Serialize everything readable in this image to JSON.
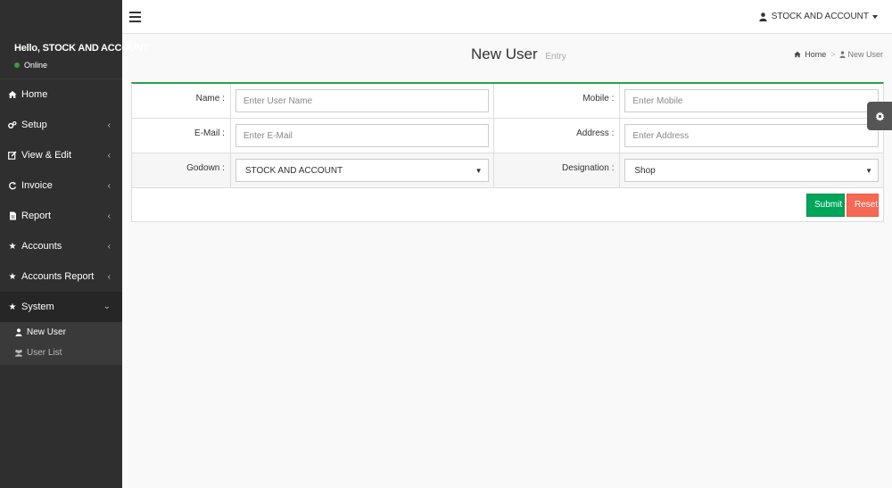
{
  "sidebar": {
    "greeting": "Hello, STOCK AND ACCOUNT",
    "status": "Online",
    "items": [
      {
        "label": "Home",
        "icon": "home-icon",
        "has_children": false
      },
      {
        "label": "Setup",
        "icon": "cogs-icon",
        "has_children": true
      },
      {
        "label": "View & Edit",
        "icon": "edit-icon",
        "has_children": true
      },
      {
        "label": "Invoice",
        "icon": "refresh-icon",
        "has_children": true
      },
      {
        "label": "Report",
        "icon": "file-icon",
        "has_children": true
      },
      {
        "label": "Accounts",
        "icon": "star-icon",
        "has_children": true
      },
      {
        "label": "Accounts Report",
        "icon": "star-icon",
        "has_children": true
      }
    ],
    "system": {
      "label": "System",
      "icon": "star-icon",
      "children": [
        {
          "label": "New User",
          "icon": "user-icon"
        },
        {
          "label": "User List",
          "icon": "users-icon"
        }
      ]
    }
  },
  "header": {
    "user_name": "STOCK AND ACCOUNT"
  },
  "page": {
    "title": "New User",
    "subtitle": "Entry",
    "breadcrumb": {
      "home": "Home",
      "current": "New User"
    }
  },
  "form": {
    "name": {
      "label": "Name :",
      "placeholder": "Enter User Name"
    },
    "mobile": {
      "label": "Mobile :",
      "placeholder": "Enter Mobile"
    },
    "email": {
      "label": "E-Mail :",
      "placeholder": "Enter E-Mail"
    },
    "address": {
      "label": "Address :",
      "placeholder": "Enter Address"
    },
    "godown": {
      "label": "Godown :",
      "value": "STOCK AND ACCOUNT"
    },
    "designation": {
      "label": "Designation :",
      "value": "Shop"
    },
    "submit_label": "Submit",
    "reset_label": "Reset"
  },
  "colors": {
    "sidebar_bg": "#2f2f2f",
    "box_accent": "#2aa14a",
    "submit": "#00a65a",
    "reset": "#f56954",
    "online_dot": "#3c9c3c"
  }
}
